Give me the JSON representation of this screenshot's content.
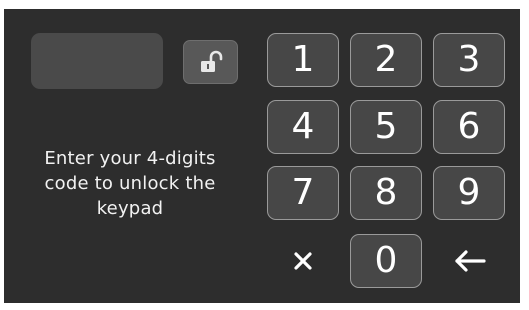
{
  "display": {
    "code_value": ""
  },
  "instruction": {
    "text": "Enter your 4-digits\ncode to unlock the\nkeypad"
  },
  "lock": {
    "icon": "unlocked-padlock-icon"
  },
  "keypad": {
    "keys": [
      "1",
      "2",
      "3",
      "4",
      "5",
      "6",
      "7",
      "8",
      "9",
      "0"
    ],
    "clear_icon": "close-icon",
    "backspace_icon": "arrow-left-icon"
  },
  "colors": {
    "background": "#2d2d2d",
    "key_fill": "#474747",
    "key_border": "#9a9a9a",
    "display_fill": "#4a4a4a",
    "text": "#f2f2f2"
  }
}
